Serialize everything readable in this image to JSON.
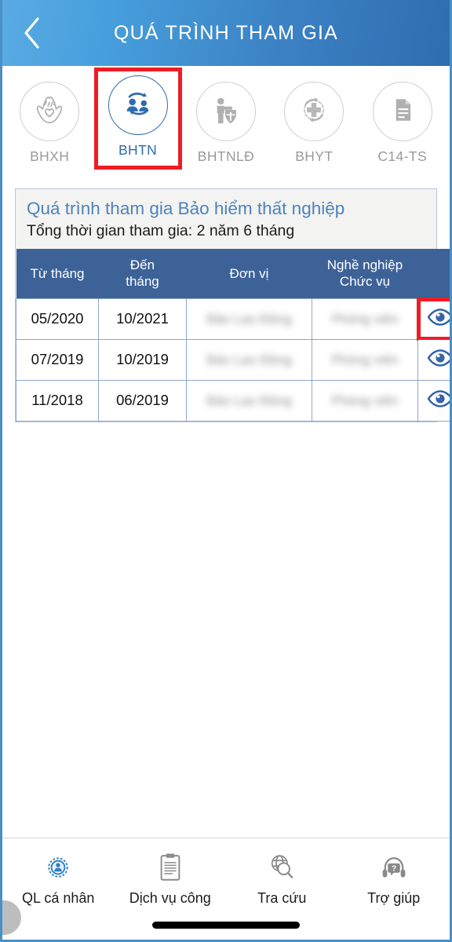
{
  "appbar": {
    "title": "QUÁ TRÌNH THAM GIA",
    "back_icon": "chevron-left-icon",
    "gradient_from": "#5aabe3",
    "gradient_to": "#2f6db0"
  },
  "tabs": {
    "selected": "BHTN",
    "highlight_color": "#ee1c25",
    "active_color": "#2e6bb0",
    "inactive_color": "#9a9a9a",
    "items": [
      {
        "label": "BHXH",
        "icon": "hands-heart-icon",
        "active": false
      },
      {
        "label": "BHTN",
        "icon": "people-recycle-icon",
        "active": true
      },
      {
        "label": "BHTNLĐ",
        "icon": "worker-shield-icon",
        "active": false
      },
      {
        "label": "BHYT",
        "icon": "cross-arrows-icon",
        "active": false
      },
      {
        "label": "C14-TS",
        "icon": "document-icon",
        "active": false
      }
    ]
  },
  "card": {
    "title": "Quá trình tham gia Bảo hiểm thất nghiệp",
    "subtitle": "Tổng thời gian tham gia: 2 năm 6 tháng",
    "title_color": "#4f82bb"
  },
  "table": {
    "header_color": "#3d6298",
    "columns": [
      "Từ tháng",
      "Đến\ntháng",
      "Đơn vị",
      "Nghề nghiệp\nChức vụ",
      ""
    ],
    "columns_flat": {
      "from": "Từ tháng",
      "to_line1": "Đến",
      "to_line2": "tháng",
      "unit": "Đơn vị",
      "job_line1": "Nghề nghiệp",
      "job_line2": "Chức vụ",
      "action": ""
    },
    "rows": [
      {
        "from": "05/2020",
        "to": "10/2021",
        "unit": "Bảo Lao Động",
        "job": "Phóng viên",
        "unit_redacted": true,
        "job_redacted": true,
        "action_icon": "eye-icon",
        "action_highlighted": true
      },
      {
        "from": "07/2019",
        "to": "10/2019",
        "unit": "Báo Lao Động",
        "job": "Phóng viên",
        "unit_redacted": true,
        "job_redacted": true,
        "action_icon": "eye-icon",
        "action_highlighted": false
      },
      {
        "from": "11/2018",
        "to": "06/2019",
        "unit": "Báo Lao Động",
        "job": "Phóng viên",
        "unit_redacted": true,
        "job_redacted": true,
        "action_icon": "eye-icon",
        "action_highlighted": false
      }
    ]
  },
  "bottomnav": {
    "items": [
      {
        "label": "QL cá nhân",
        "icon": "gear-person-icon",
        "active": true
      },
      {
        "label": "Dịch vụ công",
        "icon": "clipboard-icon",
        "active": false
      },
      {
        "label": "Tra cứu",
        "icon": "globe-search-icon",
        "active": false
      },
      {
        "label": "Trợ giúp",
        "icon": "headset-help-icon",
        "active": false
      }
    ]
  }
}
